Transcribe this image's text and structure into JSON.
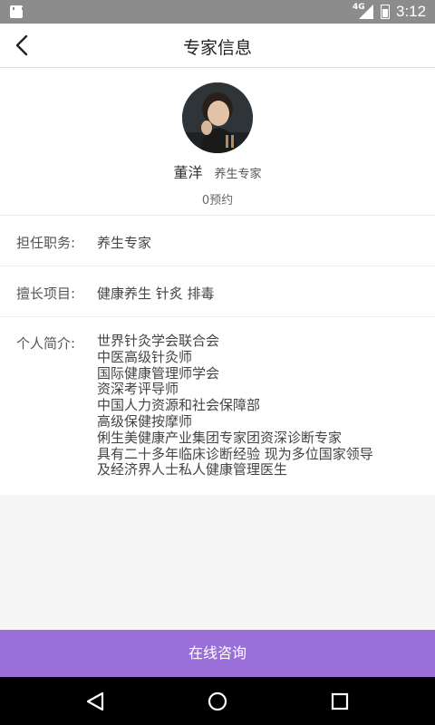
{
  "status_bar": {
    "network": "4G",
    "time": "3:12"
  },
  "header": {
    "title": "专家信息"
  },
  "profile": {
    "name": "董洋",
    "title": "养生专家",
    "appointments": "0预约"
  },
  "info": {
    "position_label": "担任职务:",
    "position_value": "养生专家",
    "skills_label": "擅长项目:",
    "skills_value": "健康养生 针炙 排毒",
    "bio_label": "个人简介:",
    "bio_lines": [
      "世界针灸学会联合会",
      "中医高级针灸师",
      "国际健康管理师学会",
      "资深考评导师",
      "中国人力资源和社会保障部",
      "高级保健按摩师",
      "俐生美健康产业集团专家团资深诊断专家",
      "具有二十多年临床诊断经验  现为多位国家领导",
      "及经济界人士私人健康管理医生"
    ]
  },
  "footer": {
    "consult_label": "在线咨询"
  },
  "colors": {
    "accent": "#9a70d8",
    "status_bar": "#8c8c8c"
  }
}
